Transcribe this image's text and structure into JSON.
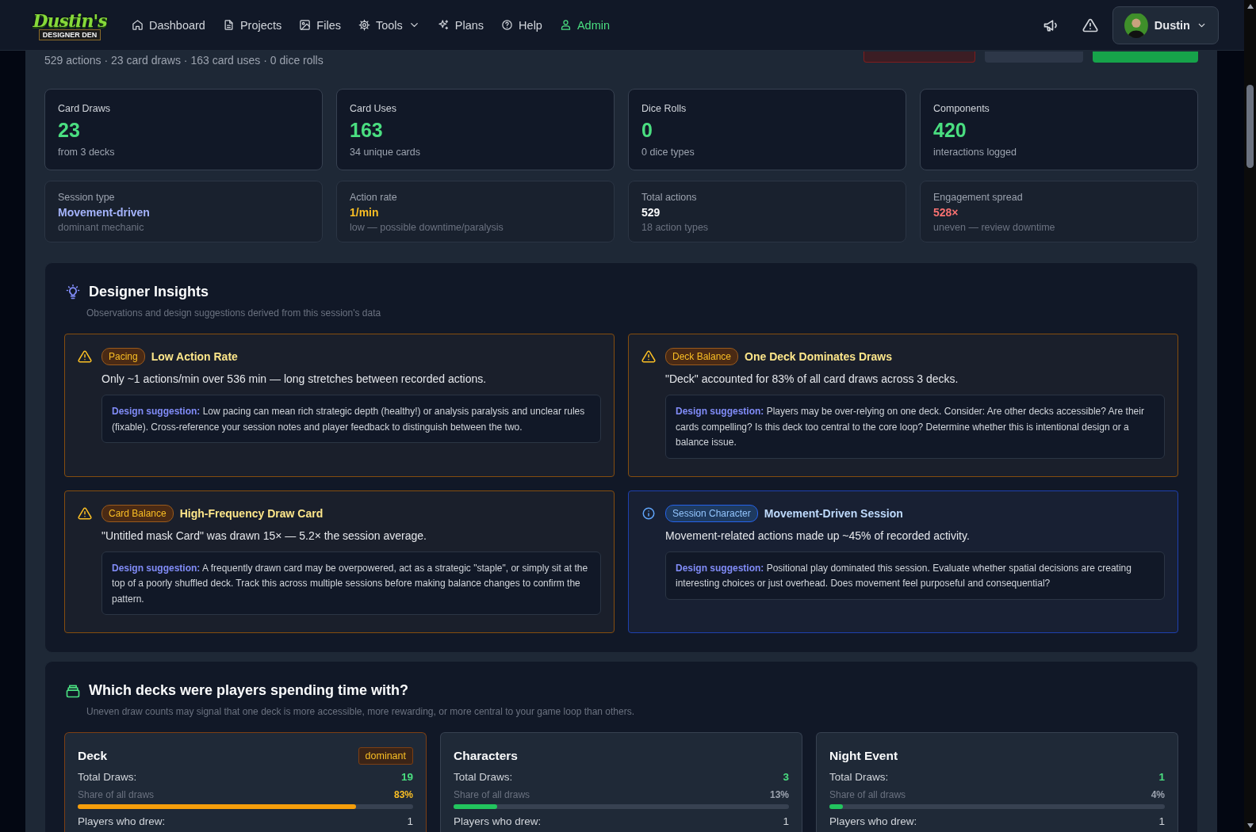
{
  "header": {
    "logo": {
      "title": "Dustin's",
      "subtitle": "DESIGNER DEN"
    },
    "nav": [
      {
        "label": "Dashboard",
        "selected": false,
        "has_menu": false
      },
      {
        "label": "Projects",
        "selected": false,
        "has_menu": false
      },
      {
        "label": "Files",
        "selected": false,
        "has_menu": false
      },
      {
        "label": "Tools",
        "selected": false,
        "has_menu": true
      },
      {
        "label": "Plans",
        "selected": false,
        "has_menu": false
      },
      {
        "label": "Help",
        "selected": false,
        "has_menu": false
      },
      {
        "label": "Admin",
        "selected": true,
        "has_menu": false
      }
    ],
    "user": {
      "name": "Dustin"
    }
  },
  "summary": "529 actions · 23 card draws · 163 card uses · 0 dice rolls",
  "actions": [
    {
      "kind": "danger"
    },
    {
      "kind": "secondary"
    },
    {
      "kind": "primary"
    }
  ],
  "stats": [
    {
      "label": "Card Draws",
      "value": "23",
      "note": "from 3 decks"
    },
    {
      "label": "Card Uses",
      "value": "163",
      "note": "34 unique cards"
    },
    {
      "label": "Dice Rolls",
      "value": "0",
      "note": "0 dice types"
    },
    {
      "label": "Components",
      "value": "420",
      "note": "interactions logged"
    }
  ],
  "metrics": [
    {
      "label": "Session type",
      "value": "Movement-driven",
      "note": "dominant mechanic",
      "color": "#a5b4fc"
    },
    {
      "label": "Action rate",
      "value": "1/min",
      "note": "low — possible downtime/paralysis",
      "color": "#fbbf24"
    },
    {
      "label": "Total actions",
      "value": "529",
      "note": "18 action types",
      "color": "#f9fafb"
    },
    {
      "label": "Engagement spread",
      "value": "528×",
      "note": "uneven — review downtime",
      "color": "#f87171"
    }
  ],
  "insights": {
    "title": "Designer Insights",
    "subtitle": "Observations and design suggestions derived from this session's data",
    "items": [
      {
        "kind": "warning",
        "tag": "Pacing",
        "title": "Low Action Rate",
        "text": "Only ~1 actions/min over 536 min — long stretches between recorded actions.",
        "suggestion": "**Design suggestion:** Low pacing can mean rich strategic depth (healthy!) or analysis paralysis and unclear rules (fixable). Cross-reference your session notes and player feedback to distinguish between the two."
      },
      {
        "kind": "warning",
        "tag": "Deck Balance",
        "title": "One Deck Dominates Draws",
        "text": "\"Deck\" accounted for 83% of all card draws across 3 decks.",
        "suggestion": "**Design suggestion:** Players may be over-relying on one deck. Consider: Are other decks accessible? Are their cards compelling? Is this deck too central to the core loop? Determine whether this is intentional design or a balance issue."
      },
      {
        "kind": "warning",
        "tag": "Card Balance",
        "title": "High-Frequency Draw Card",
        "text": "\"Untitled mask Card\" was drawn 15× — 5.2× the session average.",
        "suggestion": "**Design suggestion:** A frequently drawn card may be overpowered, act as a strategic \"staple\", or simply sit at the top of a poorly shuffled deck. Track this across multiple sessions before making balance changes to confirm the pattern."
      },
      {
        "kind": "info",
        "tag": "Session Character",
        "title": "Movement-Driven Session",
        "text": "Movement-related actions made up ~45% of recorded activity.",
        "suggestion": "**Design suggestion:** Positional play dominated this session. Evaluate whether spatial decisions are creating interesting choices or just overhead. Does movement feel purposeful and consequential?"
      }
    ]
  },
  "decks": {
    "title": "Which decks were players spending time with?",
    "subtitle": "Uneven draw counts may signal that one deck is more accessible, more rewarding, or more central to your game loop than others.",
    "items": [
      {
        "name": "Deck",
        "badge": "dominant",
        "dominant": true,
        "total_label": "Total Draws:",
        "total": "19",
        "share_label": "Share of all draws",
        "share": "83%",
        "level": 0.83,
        "players_label": "Players who drew:",
        "players": "1"
      },
      {
        "name": "Characters",
        "dominant": false,
        "total_label": "Total Draws:",
        "total": "3",
        "share_label": "Share of all draws",
        "share": "13%",
        "level": 0.13,
        "players_label": "Players who drew:",
        "players": "1"
      },
      {
        "name": "Night Event",
        "dominant": false,
        "total_label": "Total Draws:",
        "total": "1",
        "share_label": "Share of all draws",
        "share": "4%",
        "level": 0.04,
        "players_label": "Players who drew:",
        "players": "1"
      }
    ]
  }
}
